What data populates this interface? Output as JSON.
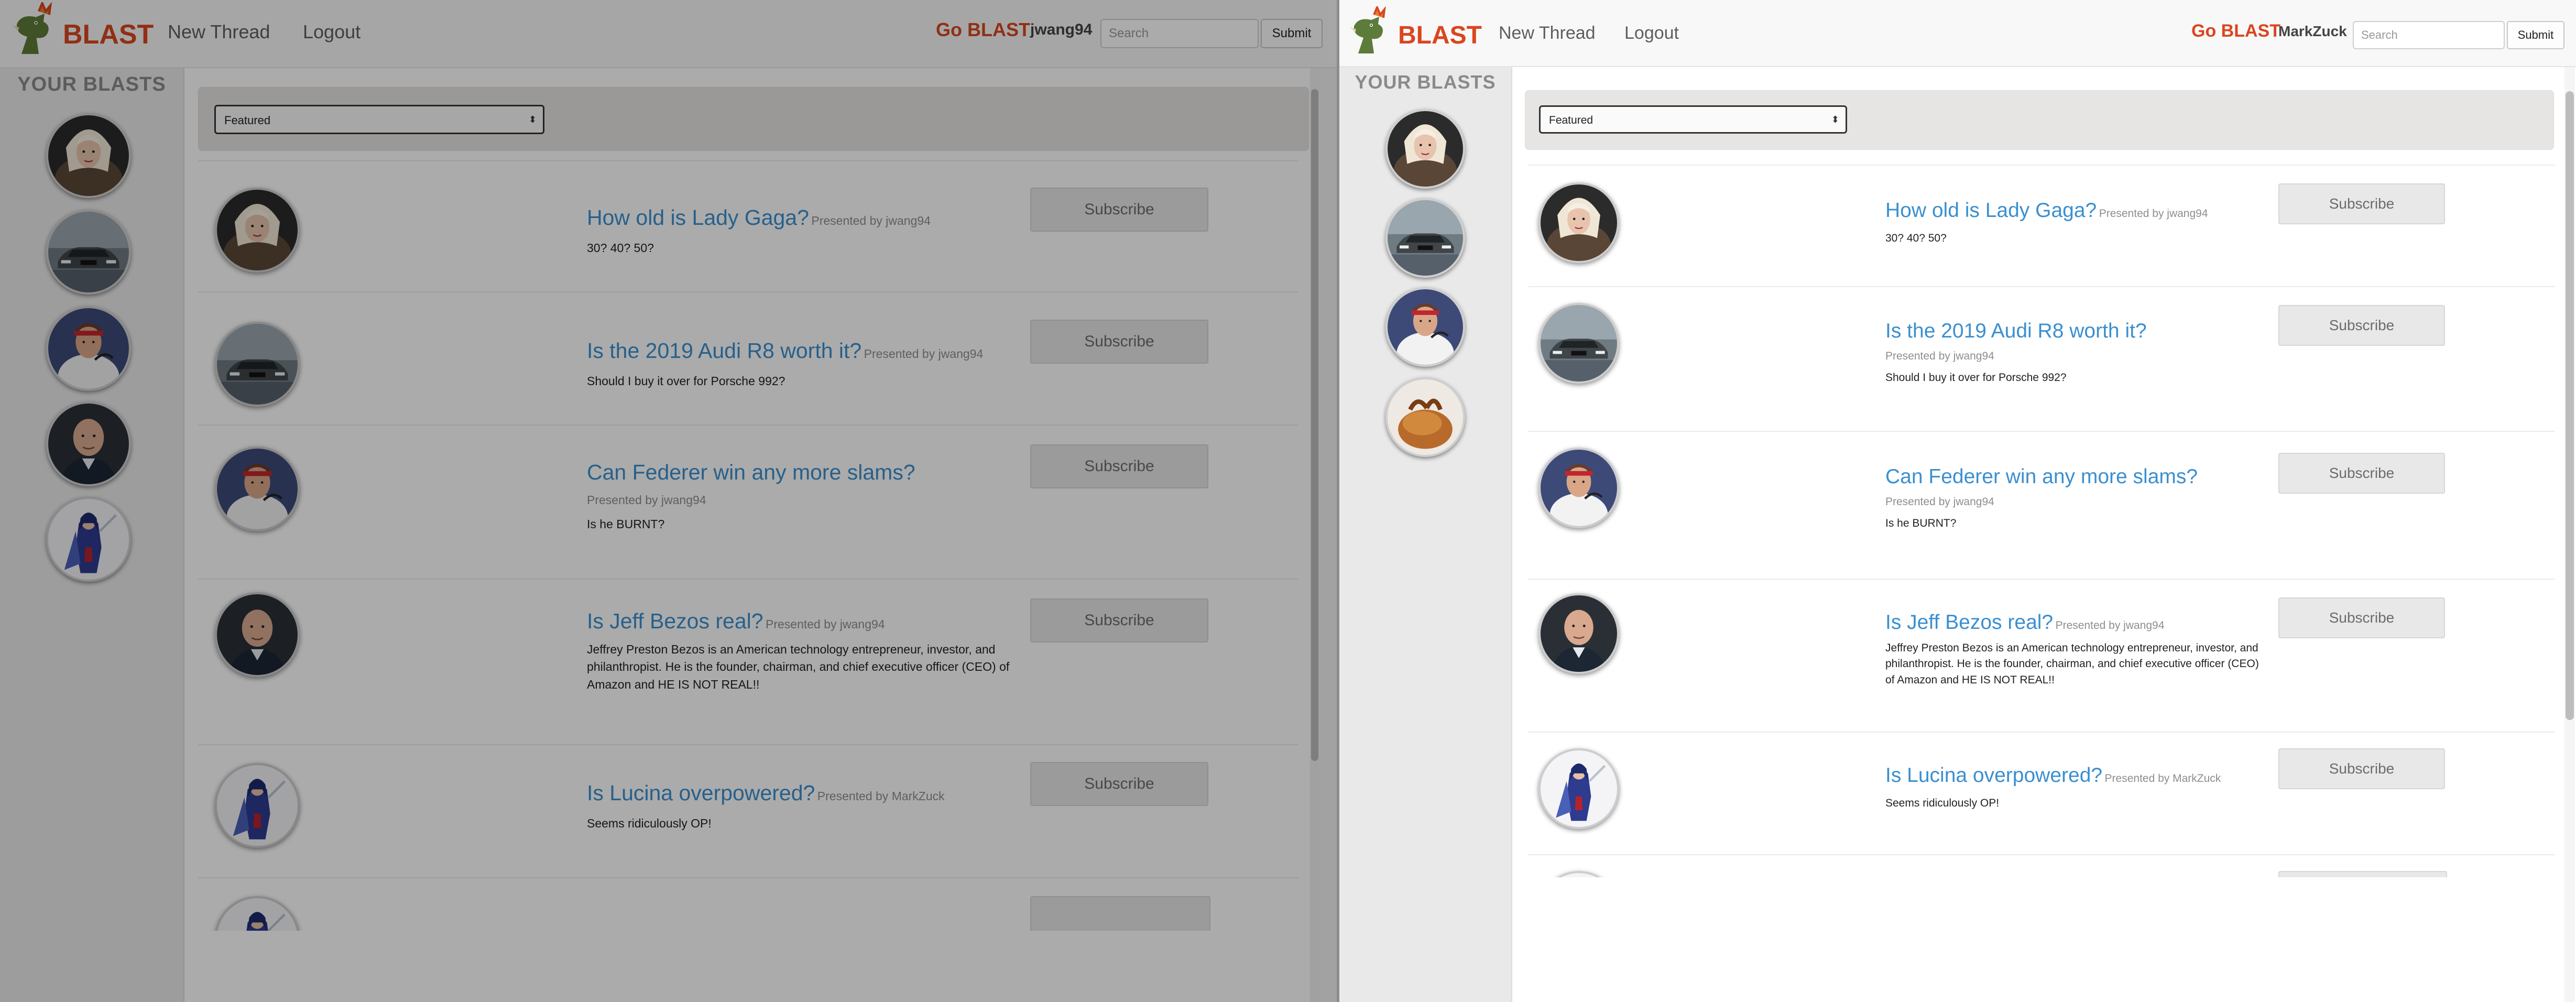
{
  "colors": {
    "brand": "#d9461f",
    "link": "#3a8fd0"
  },
  "left": {
    "brand": "BLAST",
    "nav": {
      "new_thread": "New Thread",
      "logout": "Logout"
    },
    "go_blast": "Go BLAST",
    "username": "jwang94",
    "search": {
      "placeholder": "Search",
      "value": ""
    },
    "submit": "Submit",
    "sidebar_title": "YOUR BLASTS",
    "sidebar_items": [
      {
        "icon": "lady-gaga-avatar"
      },
      {
        "icon": "audi-car-avatar"
      },
      {
        "icon": "federer-avatar"
      },
      {
        "icon": "jeff-bezos-avatar"
      },
      {
        "icon": "lucina-avatar"
      }
    ],
    "filter": {
      "selected": "Featured"
    },
    "posts": [
      {
        "title": "How old is Lady Gaga?",
        "presented": "Presented by jwang94",
        "body": "30? 40? 50?",
        "subscribe": "Subscribe",
        "avatar": "lady-gaga-avatar"
      },
      {
        "title": "Is the 2019 Audi R8 worth it?",
        "presented": "Presented by jwang94",
        "body": "Should I buy it over for Porsche 992?",
        "subscribe": "Subscribe",
        "avatar": "audi-car-avatar"
      },
      {
        "title": "Can Federer win any more slams?",
        "presented": "Presented by jwang94",
        "body": "Is he BURNT?",
        "subscribe": "Subscribe",
        "avatar": "federer-avatar"
      },
      {
        "title": "Is Jeff Bezos real?",
        "presented": "Presented by jwang94",
        "body": "Jeffrey Preston Bezos is an American technology entrepreneur, investor, and philanthropist. He is the founder, chairman, and chief executive officer (CEO) of Amazon and HE IS NOT REAL!!",
        "subscribe": "Subscribe",
        "avatar": "jeff-bezos-avatar"
      },
      {
        "title": "Is Lucina overpowered?",
        "presented": "Presented by MarkZuck",
        "body": "Seems ridiculously OP!",
        "subscribe": "Subscribe",
        "avatar": "lucina-avatar"
      }
    ]
  },
  "right": {
    "brand": "BLAST",
    "nav": {
      "new_thread": "New Thread",
      "logout": "Logout"
    },
    "go_blast": "Go BLAST",
    "username": "MarkZuck",
    "search": {
      "placeholder": "Search",
      "value": ""
    },
    "submit": "Submit",
    "sidebar_title": "YOUR BLASTS",
    "sidebar_items": [
      {
        "icon": "lady-gaga-avatar"
      },
      {
        "icon": "audi-car-avatar"
      },
      {
        "icon": "federer-avatar"
      },
      {
        "icon": "bread-roll-avatar"
      }
    ],
    "filter": {
      "selected": "Featured"
    },
    "posts": [
      {
        "title": "How old is Lady Gaga?",
        "presented": "Presented by jwang94",
        "body": "30? 40? 50?",
        "subscribe": "Subscribe",
        "avatar": "lady-gaga-avatar"
      },
      {
        "title": "Is the 2019 Audi R8 worth it?",
        "presented": "Presented by jwang94",
        "body": "Should I buy it over for Porsche 992?",
        "subscribe": "Subscribe",
        "avatar": "audi-car-avatar"
      },
      {
        "title": "Can Federer win any more slams?",
        "presented": "Presented by jwang94",
        "body": "Is he BURNT?",
        "subscribe": "Subscribe",
        "avatar": "federer-avatar"
      },
      {
        "title": "Is Jeff Bezos real?",
        "presented": "Presented by jwang94",
        "body": "Jeffrey Preston Bezos is an American technology entrepreneur, investor, and philanthropist. He is the founder, chairman, and chief executive officer (CEO) of Amazon and HE IS NOT REAL!!",
        "subscribe": "Subscribe",
        "avatar": "jeff-bezos-avatar"
      },
      {
        "title": "Is Lucina overpowered?",
        "presented": "Presented by MarkZuck",
        "body": "Seems ridiculously OP!",
        "subscribe": "Subscribe",
        "avatar": "lucina-avatar"
      }
    ]
  }
}
